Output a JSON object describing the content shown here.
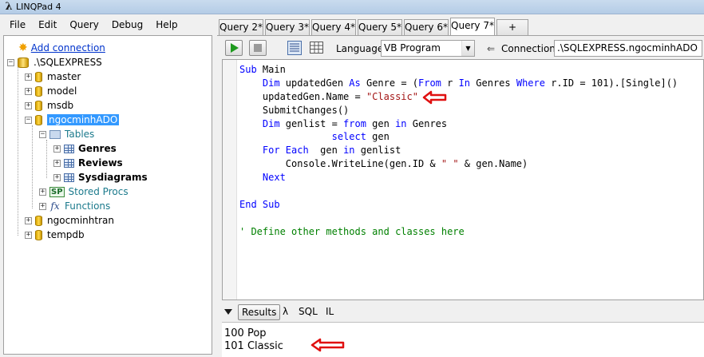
{
  "window": {
    "title": "LINQPad 4"
  },
  "menu": [
    "File",
    "Edit",
    "Query",
    "Debug",
    "Help"
  ],
  "tree": {
    "add_connection": "Add connection",
    "server": ".\\SQLEXPRESS",
    "databases": [
      "master",
      "model",
      "msdb",
      "ngocminhADO",
      "ngocminhtran",
      "tempdb"
    ],
    "selected_db": "ngocminhADO",
    "tables_label": "Tables",
    "tables": [
      "Genres",
      "Reviews",
      "Sysdiagrams"
    ],
    "stored_procs": "Stored Procs",
    "functions": "Functions",
    "sp_badge": "SP",
    "fx_badge": "fx"
  },
  "tabs": {
    "items": [
      "Query 2*",
      "Query 3*",
      "Query 4*",
      "Query 5*",
      "Query 6*",
      "Query 7*"
    ],
    "active": "Query 7*",
    "new_tab": "+"
  },
  "toolbar": {
    "language_label": "Language",
    "language_value": "VB Program",
    "connection_label": "Connection",
    "connection_value": ".\\SQLEXPRESS.ngocminhADO"
  },
  "code_lines": [
    [
      {
        "t": "Sub ",
        "c": "kw"
      },
      {
        "t": "Main",
        "c": ""
      }
    ],
    [
      {
        "t": "    Dim ",
        "c": "kw"
      },
      {
        "t": "updatedGen ",
        "c": ""
      },
      {
        "t": "As ",
        "c": "kw"
      },
      {
        "t": "Genre = (",
        "c": ""
      },
      {
        "t": "From ",
        "c": "kw"
      },
      {
        "t": "r ",
        "c": ""
      },
      {
        "t": "In ",
        "c": "kw"
      },
      {
        "t": "Genres ",
        "c": ""
      },
      {
        "t": "Where ",
        "c": "kw"
      },
      {
        "t": "r.ID = 101).[Single]()",
        "c": ""
      }
    ],
    [
      {
        "t": "    updatedGen.Name = ",
        "c": ""
      },
      {
        "t": "\"Classic\"",
        "c": "str"
      }
    ],
    [
      {
        "t": "    SubmitChanges()",
        "c": ""
      }
    ],
    [
      {
        "t": "    Dim ",
        "c": "kw"
      },
      {
        "t": "genlist = ",
        "c": ""
      },
      {
        "t": "from ",
        "c": "kw"
      },
      {
        "t": "gen ",
        "c": ""
      },
      {
        "t": "in ",
        "c": "kw"
      },
      {
        "t": "Genres",
        "c": ""
      }
    ],
    [
      {
        "t": "                ",
        "c": ""
      },
      {
        "t": "select ",
        "c": "kw"
      },
      {
        "t": "gen",
        "c": ""
      }
    ],
    [
      {
        "t": "    For Each  ",
        "c": "kw"
      },
      {
        "t": "gen ",
        "c": ""
      },
      {
        "t": "in ",
        "c": "kw"
      },
      {
        "t": "genlist",
        "c": ""
      }
    ],
    [
      {
        "t": "        Console.WriteLine(gen.ID & ",
        "c": ""
      },
      {
        "t": "\" \"",
        "c": "str"
      },
      {
        "t": " & gen.Name)",
        "c": ""
      }
    ],
    [
      {
        "t": "    Next",
        "c": "kw"
      }
    ],
    [
      {
        "t": "",
        "c": ""
      }
    ],
    [
      {
        "t": "End Sub",
        "c": "kw"
      }
    ],
    [
      {
        "t": "",
        "c": ""
      }
    ],
    [
      {
        "t": "' Define other methods and classes here",
        "c": "cmt"
      }
    ]
  ],
  "results": {
    "tabs": [
      "Results",
      "λ",
      "SQL",
      "IL"
    ],
    "active": "Results",
    "output": [
      "100 Pop",
      "101 Classic"
    ]
  },
  "colors": {
    "annotation_arrow": "#e01010",
    "selection": "#3399ff",
    "keyword": "#0000ff"
  }
}
